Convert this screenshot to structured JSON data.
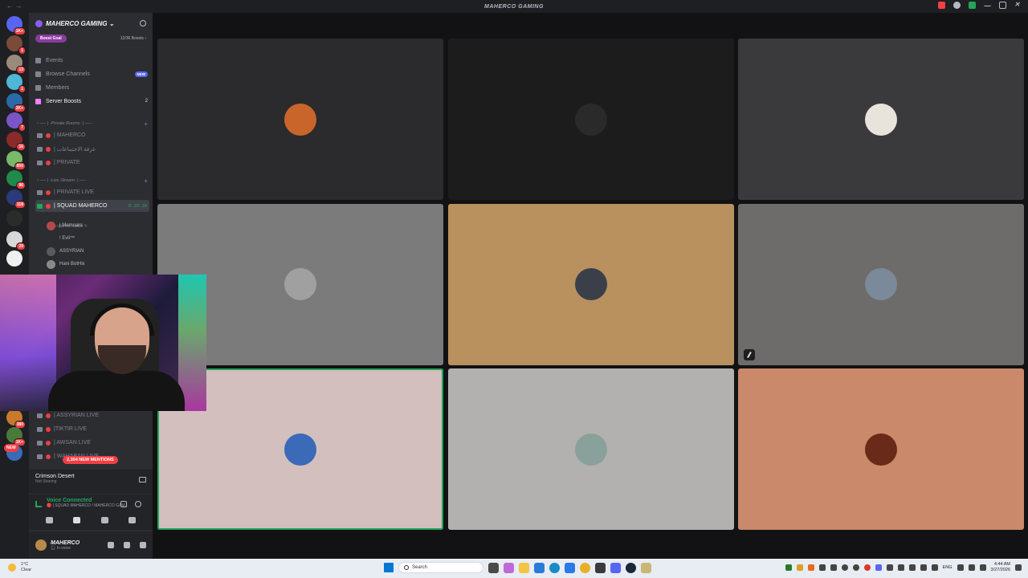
{
  "titlebar": {
    "title": "MAHERCO GAMING",
    "nav": "← →"
  },
  "servers": [
    {
      "badge": "1K+",
      "color": "#5865f2"
    },
    {
      "badge": "1",
      "color": "#7a4a3a"
    },
    {
      "badge": "13",
      "color": "#9a8a7a"
    },
    {
      "badge": "1",
      "color": "#4fb6d6"
    },
    {
      "badge": "2K+",
      "color": "#2a6aa8"
    },
    {
      "badge": "7",
      "color": "#7a55c8"
    },
    {
      "badge": "16",
      "color": "#8b2a2a"
    },
    {
      "badge": "856",
      "color": "#7ab86a"
    },
    {
      "badge": "96",
      "color": "#1f8a4a"
    },
    {
      "badge": "118",
      "color": "#2a3a7a"
    },
    {
      "badge": "",
      "color": "#2b2b2b"
    },
    {
      "badge": "29",
      "color": "#d8d8d8"
    },
    {
      "badge": "",
      "color": "#f0f0f0"
    },
    {
      "badge": "380",
      "color": "#c87a2a"
    },
    {
      "badge": "1K+",
      "color": "#4a7a3a"
    },
    {
      "badge": "",
      "color": "#3a6ab8"
    }
  ],
  "servers_new": "NEW",
  "guild": {
    "name": "MAHERCO GAMING ⌄",
    "boost_goal": "Boost Goal",
    "boost_count": "12/36 Boosts ›"
  },
  "menu": [
    {
      "label": "Events",
      "extra": "",
      "type": ""
    },
    {
      "label": "Browse Channels",
      "extra": "NEW",
      "type": "new"
    },
    {
      "label": "Members",
      "extra": "",
      "type": ""
    },
    {
      "label": "Server Boosts",
      "extra": "2",
      "type": "count"
    }
  ],
  "categories": {
    "private": "› ── | ·Private Rooms· | ── ·",
    "live": "› ── | ·Live Stream· | ── ·",
    "plus": "+"
  },
  "private_channels": [
    "| MAHERCO",
    "| غرفة الاجتماعات",
    "| PRIVATE"
  ],
  "live_channels": [
    "| PRIVATE LIVE"
  ],
  "active_channel": {
    "name": "| SQUAD MAHERCO",
    "timer": "0:10:10",
    "status": "Set a channel status ✎"
  },
  "members": [
    {
      "name": "| Memoarα",
      "color": "#b24a4a"
    },
    {
      "name": "! Evil™",
      "color": "#2b2d31"
    },
    {
      "name": "ASSYRIAN",
      "color": "#5a5a5a"
    },
    {
      "name": "Hani BotHix",
      "color": "#8a8a8a"
    }
  ],
  "lower_channels": [
    "| ASSYRIAN LIVE",
    "|TIKTIR LIVE",
    "| AWSAN LIVE",
    "| WAHABAN LIVE"
  ],
  "mentions": "2,304 NEW MENTIONS",
  "activity": {
    "title": "Crimson Desert",
    "subtitle": "Not Sharing"
  },
  "voice": {
    "status": "Voice Connected",
    "channel": "🔴 | SQUAD MAHERCO / MAHERCO GAM..."
  },
  "user": {
    "name": "MAHERCO",
    "status": "🎧 In voice"
  },
  "tiles": [
    {
      "bg": "#2b2b2d",
      "avatar": "#c9652a",
      "muted": false,
      "speaking": false
    },
    {
      "bg": "#1c1c1d",
      "avatar": "#2a2a2a",
      "muted": false,
      "speaking": false
    },
    {
      "bg": "#3a3a3c",
      "avatar": "#e8e4dc",
      "muted": false,
      "speaking": false
    },
    {
      "bg": "#7b7b7b",
      "avatar": "#a0a0a0",
      "muted": false,
      "speaking": false
    },
    {
      "bg": "#b8915f",
      "avatar": "#3a3f4a",
      "muted": false,
      "speaking": false
    },
    {
      "bg": "#6e6c6a",
      "avatar": "#7a8a9a",
      "muted": true,
      "speaking": false
    },
    {
      "bg": "#d3bfbd",
      "avatar": "#3a6ab8",
      "muted": false,
      "speaking": true
    },
    {
      "bg": "#b3b1af",
      "avatar": "#8aa09a",
      "muted": false,
      "speaking": false
    },
    {
      "bg": "#c9896a",
      "avatar": "#6a2a1a",
      "muted": false,
      "speaking": false
    }
  ],
  "taskbar": {
    "weather_temp": "1°C",
    "weather_desc": "Clear",
    "search_placeholder": "Search",
    "lang": "ENG",
    "time": "4:44 AM",
    "date": "3/27/2026"
  }
}
